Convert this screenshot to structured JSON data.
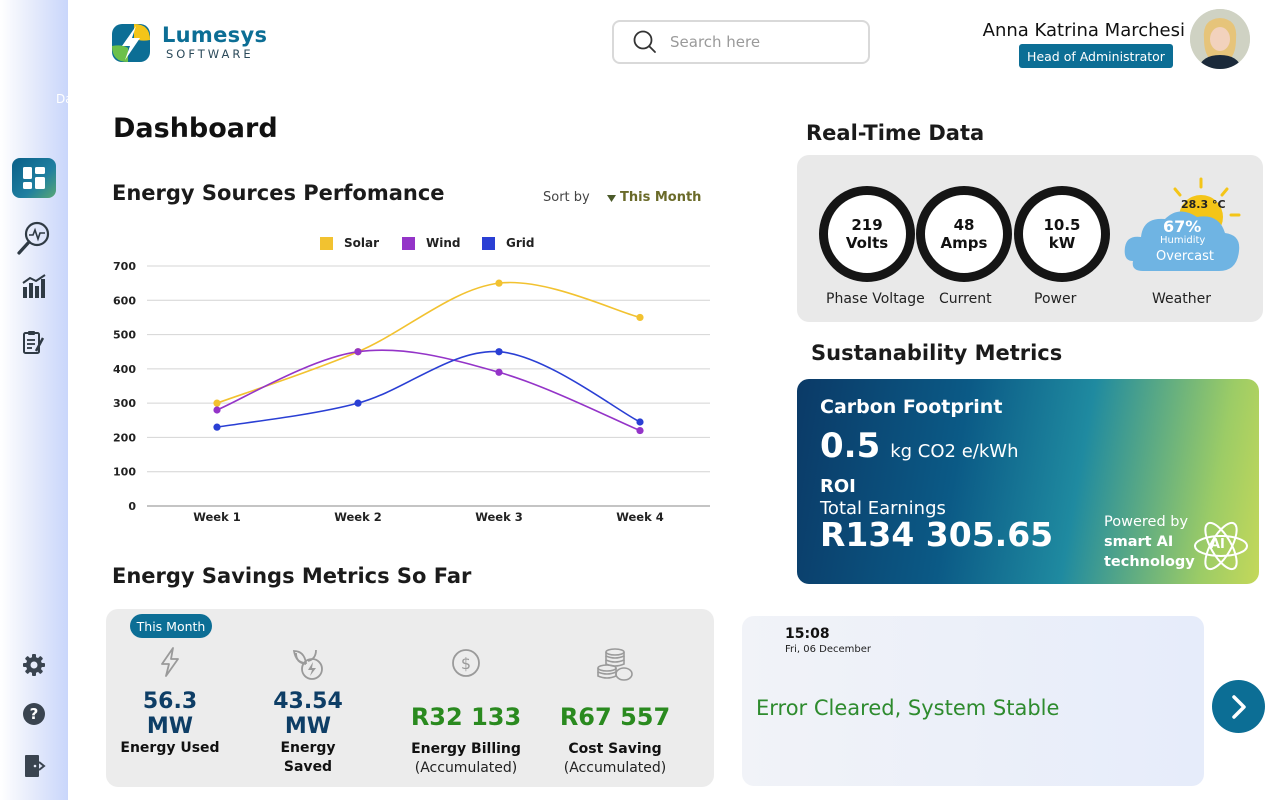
{
  "app": {
    "logo_title": "Lumesys",
    "logo_subtitle": "SOFTWARE",
    "sidebar_ghost": "Da"
  },
  "search": {
    "placeholder": "Search here"
  },
  "user": {
    "name": "Anna Katrina Marchesi",
    "role": "Head of Administrator"
  },
  "page_title": "Dashboard",
  "energy_chart": {
    "heading": "Energy Sources Perfomance",
    "sort_label": "Sort by",
    "sort_value": "This Month",
    "legend": [
      "Solar",
      "Wind",
      "Grid"
    ]
  },
  "chart_data": {
    "type": "line",
    "categories": [
      "Week 1",
      "Week 2",
      "Week 3",
      "Week 4"
    ],
    "series": [
      {
        "name": "Solar",
        "values": [
          300,
          450,
          650,
          550
        ],
        "color": "#f2c230"
      },
      {
        "name": "Wind",
        "values": [
          280,
          450,
          390,
          220
        ],
        "color": "#9434c8"
      },
      {
        "name": "Grid",
        "values": [
          230,
          300,
          450,
          245
        ],
        "color": "#2a3fd4"
      }
    ],
    "ylim": [
      0,
      700
    ],
    "yticks": [
      "0",
      "100",
      "200",
      "300",
      "400",
      "500",
      "600",
      "700"
    ],
    "grid": true,
    "legend_position": "top-center"
  },
  "realtime": {
    "heading": "Real-Time Data",
    "phase_voltage": {
      "value": "219",
      "unit": "Volts",
      "label": "Phase Voltage"
    },
    "current": {
      "value": "48",
      "unit": "Amps",
      "label": "Current"
    },
    "power": {
      "value": "10.5",
      "unit": "kW",
      "label": "Power"
    },
    "weather": {
      "temp": "28.3 °C",
      "humidity_value": "67%",
      "humidity_label": "Humidity",
      "condition": "Overcast",
      "label": "Weather"
    }
  },
  "sustainability": {
    "heading": "Sustanability Metrics",
    "carbon_title": "Carbon Footprint",
    "carbon_value": "0.5",
    "carbon_unit": "kg CO2 e/kWh",
    "roi_title": "ROI",
    "earnings_label": "Total Earnings",
    "earnings_value": "R134 305.65",
    "ai_line1": "Powered by",
    "ai_line2": "smart AI",
    "ai_line3": "technology",
    "ai_icon_text": "AI"
  },
  "savings": {
    "heading": "Energy Savings Metrics So Far",
    "badge": "This Month",
    "metrics": [
      {
        "value_line1": "56.3",
        "value_line2": "MW",
        "label": "Energy Used",
        "sub": ""
      },
      {
        "value_line1": "43.54",
        "value_line2": "MW",
        "label": "Energy Saved",
        "sub": ""
      },
      {
        "value_line1": "R32 133",
        "value_line2": "",
        "label": "Energy Billing",
        "sub": "(Accumulated)"
      },
      {
        "value_line1": "R67 557",
        "value_line2": "",
        "label": "Cost Saving",
        "sub": "(Accumulated)"
      }
    ]
  },
  "status": {
    "time": "15:08",
    "date": "Fri, 06 December",
    "message": "Error Cleared, System Stable"
  },
  "colors": {
    "brand": "#0c6e95",
    "green": "#2a8a1f",
    "status_green": "#2e8b2e"
  }
}
